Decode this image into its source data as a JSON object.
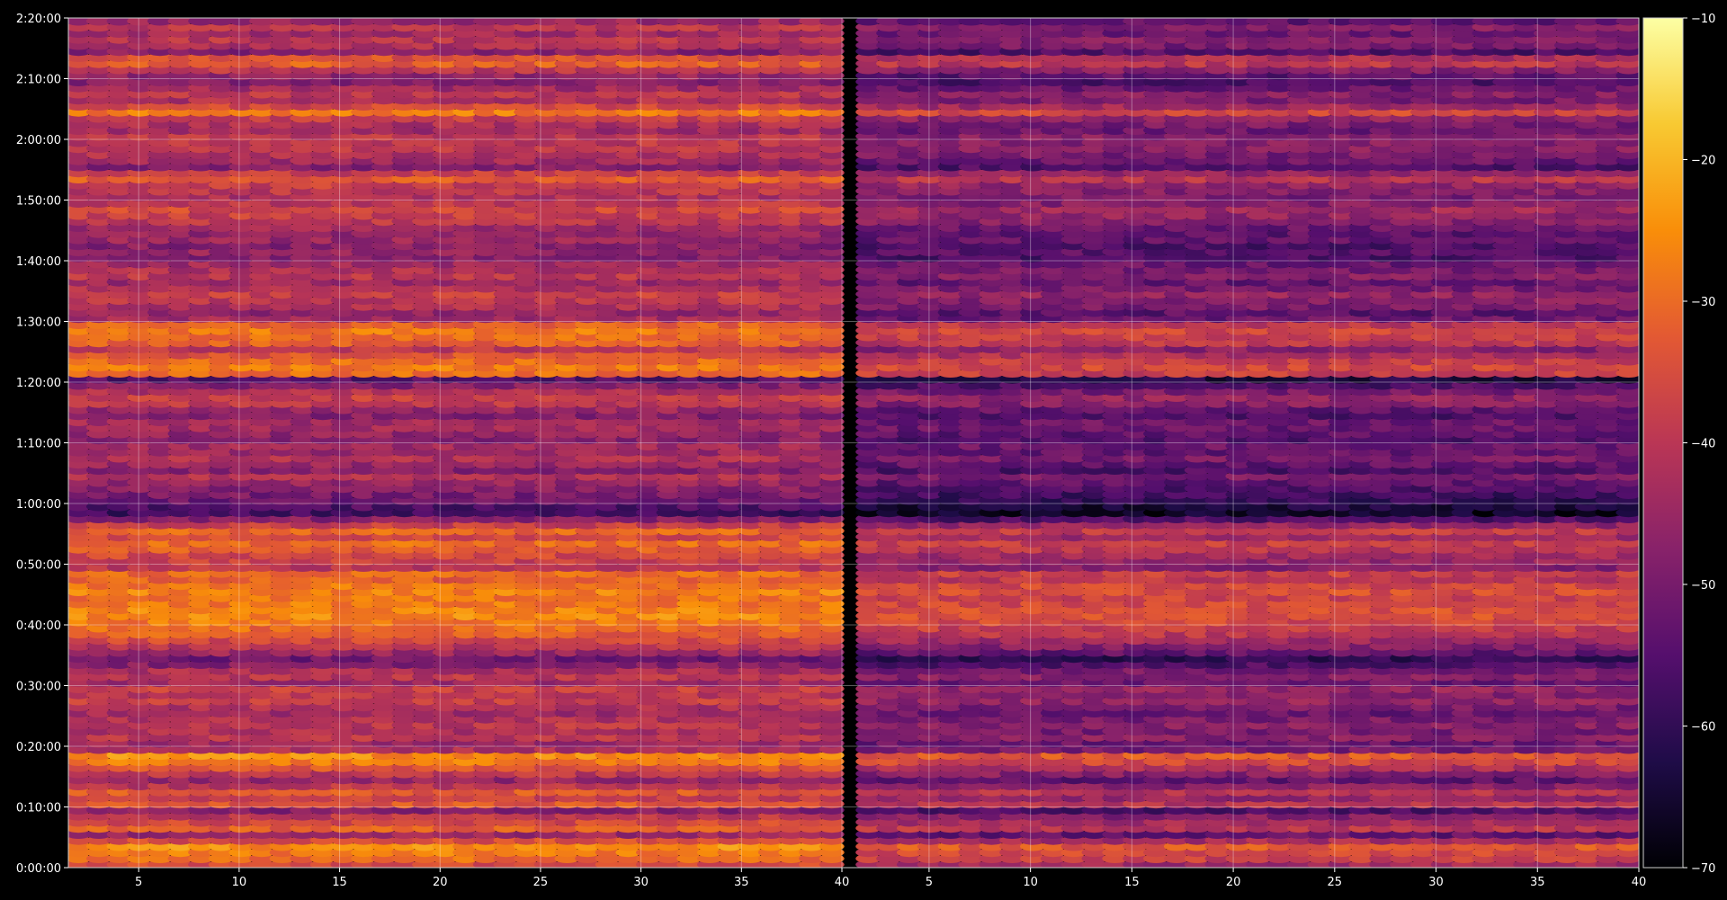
{
  "chart_data": {
    "type": "heatmap",
    "title": "",
    "xlabel": "",
    "ylabel": "",
    "colormap": "inferno",
    "background": "#000000",
    "grid": true,
    "x_range": [
      1.5,
      40
    ],
    "x_ticks": [
      "5",
      "10",
      "15",
      "20",
      "25",
      "30",
      "35",
      "40"
    ],
    "x_tick_values": [
      5,
      10,
      15,
      20,
      25,
      30,
      35,
      40
    ],
    "y_range_seconds": [
      0,
      8400
    ],
    "y_ticks": [
      "0:00:00",
      "0:10:00",
      "0:20:00",
      "0:30:00",
      "0:40:00",
      "0:50:00",
      "1:00:00",
      "1:10:00",
      "1:20:00",
      "1:30:00",
      "1:40:00",
      "1:50:00",
      "2:00:00",
      "2:10:00",
      "2:20:00"
    ],
    "y_tick_seconds": [
      0,
      600,
      1200,
      1800,
      2400,
      3000,
      3600,
      4200,
      4800,
      5400,
      6000,
      6600,
      7200,
      7800,
      8400
    ],
    "colorbar": {
      "range": [
        -70,
        -10
      ],
      "ticks": [
        "−10",
        "−20",
        "−30",
        "−40",
        "−50",
        "−60",
        "−70"
      ],
      "tick_values": [
        -10,
        -20,
        -30,
        -40,
        -50,
        -60,
        -70
      ]
    },
    "panels": 2,
    "row_profile": {
      "time_minutes": [
        0,
        1,
        2,
        3,
        4,
        5,
        6,
        7,
        8,
        9,
        10,
        11,
        12,
        13,
        14,
        15,
        16,
        17,
        18,
        19,
        20,
        21,
        22,
        23,
        24,
        25,
        26,
        27,
        28,
        29,
        30,
        31,
        32,
        33,
        34,
        35,
        36,
        37,
        38,
        39,
        40,
        41,
        42,
        43,
        44,
        45,
        46,
        47,
        48,
        49,
        50,
        51,
        52,
        53,
        54,
        55,
        56,
        57,
        58,
        59,
        60,
        61,
        62,
        63,
        64,
        65,
        66,
        67,
        68,
        69,
        70,
        71,
        72,
        73,
        74,
        75,
        76,
        77,
        78,
        79,
        80,
        81,
        82,
        83,
        84,
        85,
        86,
        87,
        88,
        89,
        90,
        91,
        92,
        93,
        94,
        95,
        96,
        97,
        98,
        99,
        100,
        101,
        102,
        103,
        104,
        105,
        106,
        107,
        108,
        109,
        110,
        111,
        112,
        113,
        114,
        115,
        116,
        117,
        118,
        119,
        120,
        121,
        122,
        123,
        124,
        125,
        126,
        127,
        128,
        129,
        130,
        131,
        132,
        133,
        134,
        135,
        136,
        137,
        138,
        139
      ],
      "left_panel_db": [
        -36,
        -30,
        -28,
        -25,
        -35,
        -45,
        -32,
        -36,
        -40,
        -48,
        -33,
        -38,
        -33,
        -40,
        -46,
        -40,
        -34,
        -28,
        -25,
        -42,
        -44,
        -40,
        -42,
        -40,
        -42,
        -44,
        -42,
        -38,
        -40,
        -38,
        -44,
        -40,
        -42,
        -48,
        -52,
        -45,
        -40,
        -36,
        -32,
        -30,
        -28,
        -26,
        -27,
        -28,
        -29,
        -27,
        -28,
        -32,
        -30,
        -40,
        -38,
        -36,
        -32,
        -30,
        -36,
        -31,
        -38,
        -48,
        -58,
        -56,
        -52,
        -50,
        -48,
        -46,
        -42,
        -48,
        -45,
        -42,
        -45,
        -44,
        -48,
        -46,
        -44,
        -44,
        -48,
        -45,
        -40,
        -38,
        -42,
        -48,
        -55,
        -30,
        -28,
        -30,
        -34,
        -40,
        -32,
        -30,
        -28,
        -32,
        -44,
        -46,
        -42,
        -40,
        -38,
        -42,
        -45,
        -40,
        -42,
        -44,
        -48,
        -46,
        -48,
        -45,
        -46,
        -44,
        -40,
        -38,
        -36,
        -40,
        -42,
        -40,
        -38,
        -32,
        -38,
        -48,
        -44,
        -42,
        -40,
        -40,
        -40,
        -44,
        -42,
        -38,
        -28,
        -36,
        -42,
        -40,
        -44,
        -48,
        -46,
        -40,
        -32,
        -34,
        -48,
        -42,
        -40,
        -44,
        -40,
        -45
      ]
    },
    "right_panel_offset_db": -8
  }
}
